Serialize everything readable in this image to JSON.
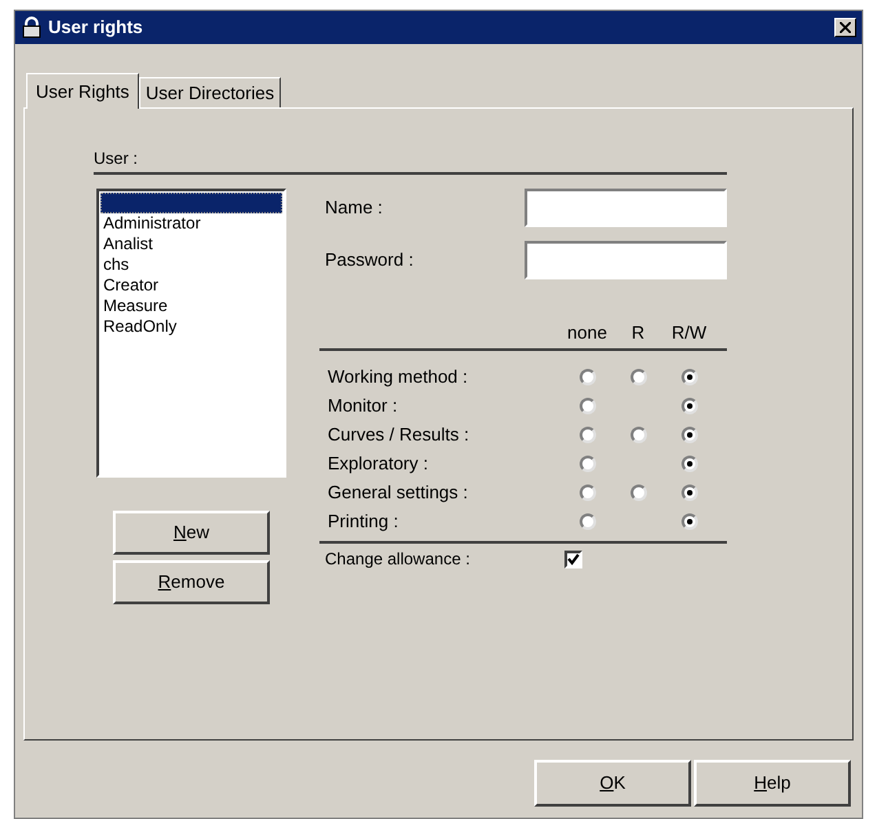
{
  "window": {
    "title": "User rights"
  },
  "tabs": [
    {
      "label": "User Rights",
      "selected": true
    },
    {
      "label": "User Directories",
      "selected": false
    }
  ],
  "user_section": {
    "label": "User :"
  },
  "users": [
    {
      "selected": true
    },
    {
      "label": "Administrator",
      "selected": false
    },
    {
      "label": "Analist",
      "selected": false
    },
    {
      "label": "chs",
      "selected": false
    },
    {
      "label": "Creator",
      "selected": false
    },
    {
      "label": "Measure",
      "selected": false
    },
    {
      "label": "ReadOnly",
      "selected": false
    }
  ],
  "user_buttons": [
    {
      "accel": "N",
      "rest": "ew"
    },
    {
      "accel": "R",
      "rest": "emove"
    }
  ],
  "fields": [
    {
      "label": "Name :"
    },
    {
      "label": "Password :"
    }
  ],
  "columns": [
    "none",
    "R",
    "R/W"
  ],
  "rights": [
    {
      "label": "Working method :",
      "options": [
        {
          "kind": "radio",
          "selected": false
        },
        {
          "kind": "radio",
          "selected": false
        },
        {
          "kind": "radio",
          "selected": true
        }
      ]
    },
    {
      "label": "Monitor :",
      "options": [
        {
          "kind": "radio",
          "selected": false
        },
        {
          "kind": "blank"
        },
        {
          "kind": "radio",
          "selected": true
        }
      ]
    },
    {
      "label": "Curves / Results :",
      "options": [
        {
          "kind": "radio",
          "selected": false
        },
        {
          "kind": "radio",
          "selected": false
        },
        {
          "kind": "radio",
          "selected": true
        }
      ]
    },
    {
      "label": "Exploratory :",
      "options": [
        {
          "kind": "radio",
          "selected": false
        },
        {
          "kind": "blank"
        },
        {
          "kind": "radio",
          "selected": true
        }
      ]
    },
    {
      "label": "General settings :",
      "options": [
        {
          "kind": "radio",
          "selected": false
        },
        {
          "kind": "radio",
          "selected": false
        },
        {
          "kind": "radio",
          "selected": true
        }
      ]
    },
    {
      "label": "Printing :",
      "options": [
        {
          "kind": "radio",
          "selected": false
        },
        {
          "kind": "blank"
        },
        {
          "kind": "radio",
          "selected": true
        }
      ]
    }
  ],
  "change_allowance": {
    "label": "Change allowance :",
    "checked": true
  },
  "buttons": [
    {
      "accel": "O",
      "rest": "K"
    },
    {
      "accel": "H",
      "rest": "elp"
    }
  ]
}
